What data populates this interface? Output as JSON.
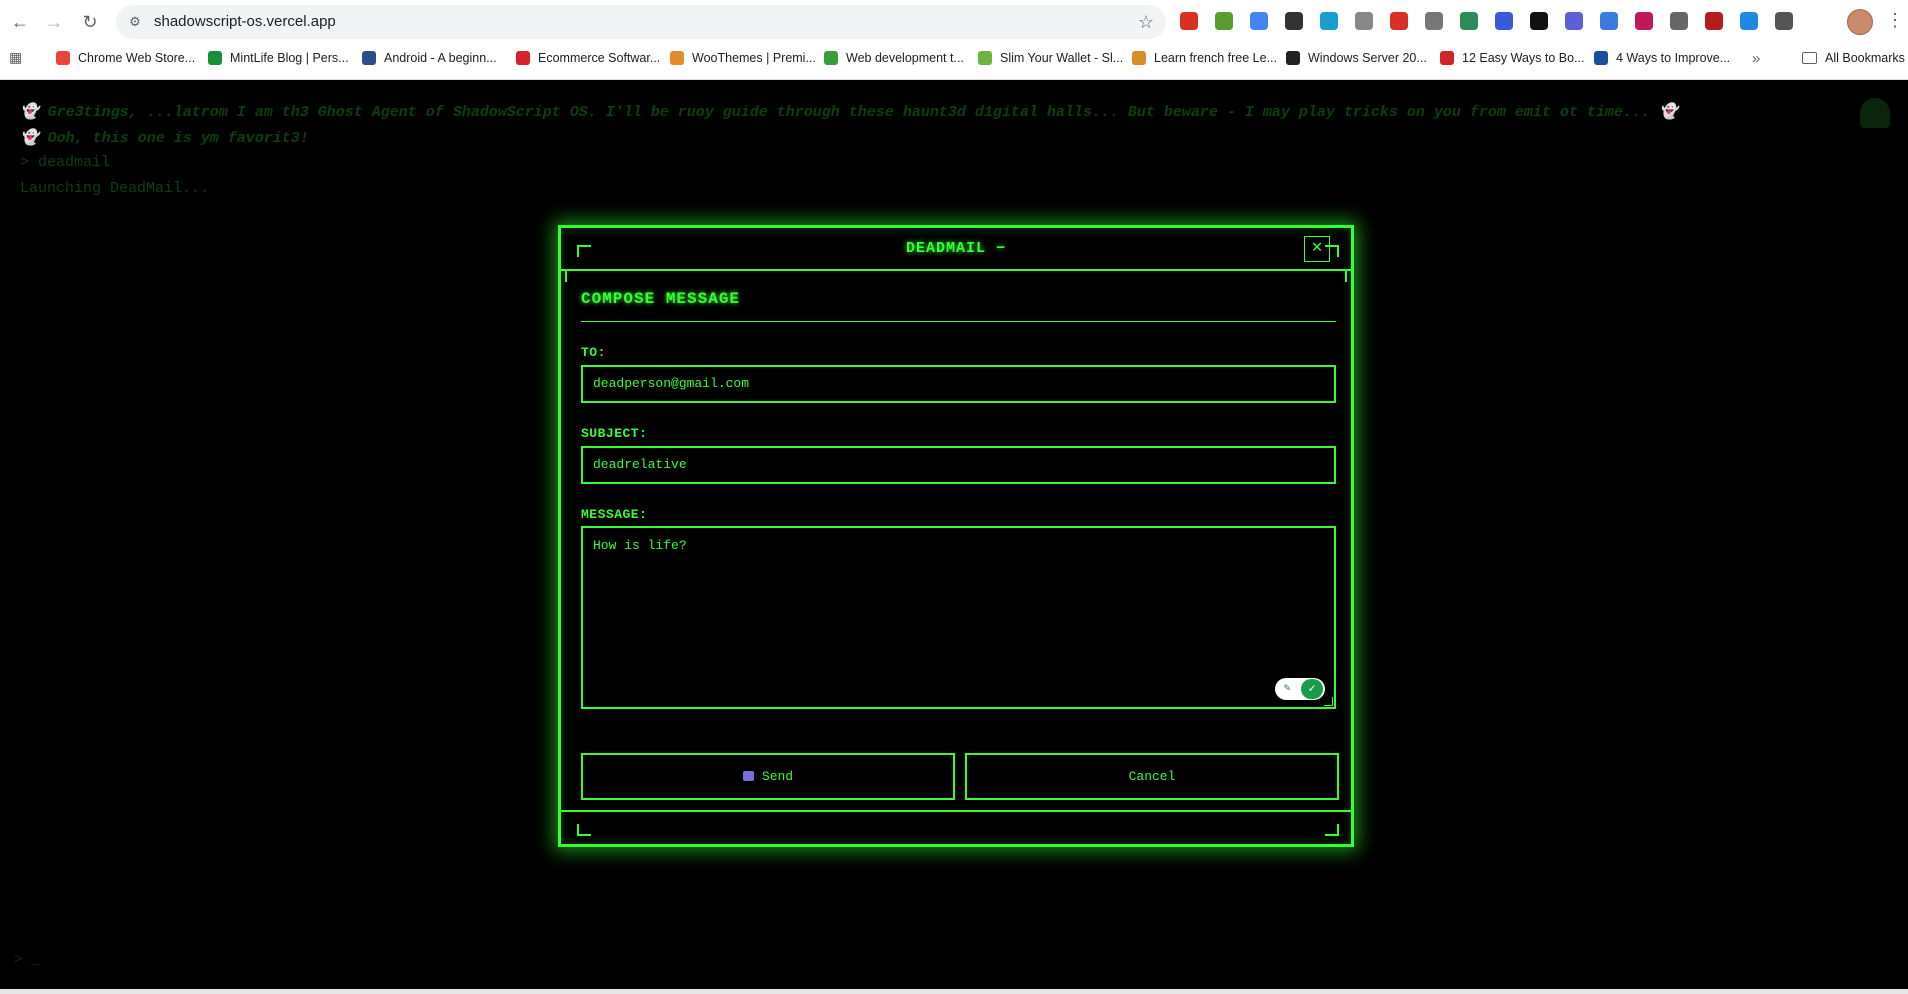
{
  "browser": {
    "url": "shadowscript-os.vercel.app",
    "bookmarks": [
      {
        "label": "Chrome Web Store...",
        "color": "#e8453c"
      },
      {
        "label": "MintLife Blog | Pers...",
        "color": "#1a8f3a"
      },
      {
        "label": "Android - A beginn...",
        "color": "#2b4d8c"
      },
      {
        "label": "Ecommerce Softwar...",
        "color": "#d2232a"
      },
      {
        "label": "WooThemes | Premi...",
        "color": "#e38c2a"
      },
      {
        "label": "Web development t...",
        "color": "#3a9d3a"
      },
      {
        "label": "Slim Your Wallet - Sl...",
        "color": "#6cb33f"
      },
      {
        "label": "Learn french free Le...",
        "color": "#d98c2a"
      },
      {
        "label": "Windows Server 20...",
        "color": "#222222"
      },
      {
        "label": "12 Easy Ways to Bo...",
        "color": "#d2232a"
      },
      {
        "label": "4 Ways to Improve...",
        "color": "#1a4fa0"
      }
    ],
    "bookmarks_overflow": "»",
    "all_bookmarks": "All Bookmarks",
    "extension_colors": [
      "#d93025",
      "#5a9d2e",
      "#4285f4",
      "#333333",
      "#1a9dcf",
      "#888888",
      "#d93025",
      "#777777",
      "#2e8b57",
      "#3a5bd9",
      "#111111",
      "#5e5ed8",
      "#3b7be0",
      "#c2185b",
      "#666666",
      "#b71c1c",
      "#1e88e5",
      "#555555"
    ]
  },
  "terminal": {
    "line1": "👻 Gre3tings, ...latrom I am th3 Ghost Agent of ShadowScript OS. I'll be ruoy guide through these haunt3d d1gital halls... But beware - I may play tricks on you from emit ot time... 👻",
    "line2": "👻 Ooh, this one is ym favorit3!",
    "line3": "> deadmail",
    "line4": "Launching DeadMail...",
    "prompt": "> _"
  },
  "modal": {
    "title": "DEADMAIL −",
    "close_label": "✕",
    "heading": "COMPOSE MESSAGE",
    "to_label": "TO:",
    "to_value": "deadperson@gmail.com",
    "subject_label": "SUBJECT:",
    "subject_value": "deadrelative",
    "message_label": "MESSAGE:",
    "message_value": "How is life?",
    "send_label": "Send",
    "cancel_label": "Cancel"
  },
  "colors": {
    "accent": "#33ff33",
    "background": "#000000"
  }
}
